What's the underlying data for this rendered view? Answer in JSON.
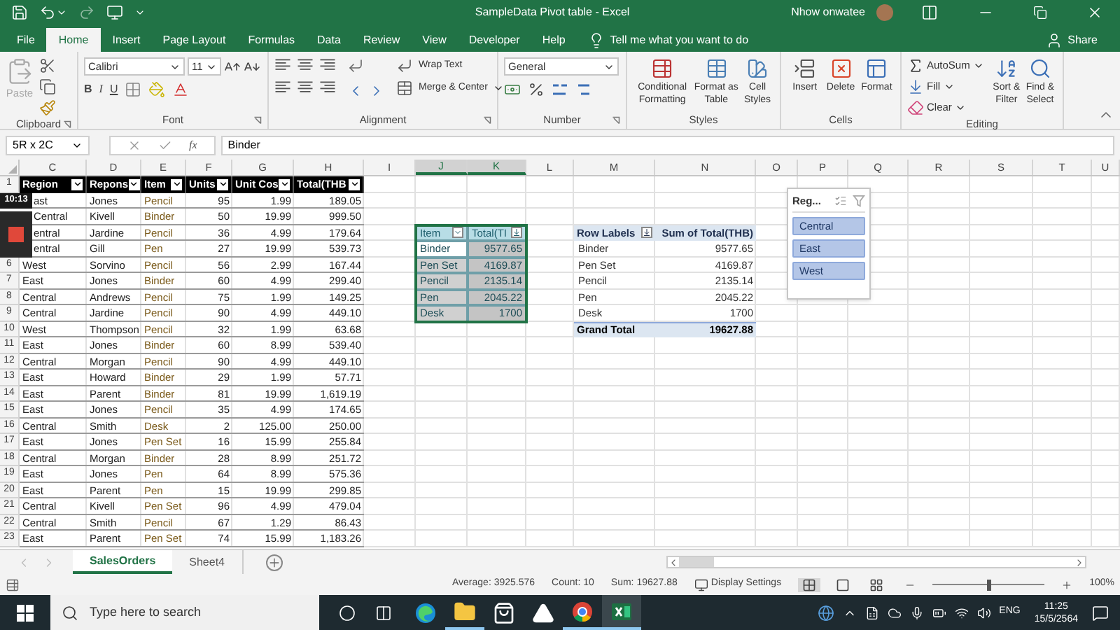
{
  "title_bar": {
    "title": "SampleData Pivot table  -  Excel",
    "user": "Nhow onwatee"
  },
  "ribbon_tabs": [
    {
      "label": "File",
      "selected": false
    },
    {
      "label": "Home",
      "selected": true
    },
    {
      "label": "Insert",
      "selected": false
    },
    {
      "label": "Page Layout",
      "selected": false
    },
    {
      "label": "Formulas",
      "selected": false
    },
    {
      "label": "Data",
      "selected": false
    },
    {
      "label": "Review",
      "selected": false
    },
    {
      "label": "View",
      "selected": false
    },
    {
      "label": "Developer",
      "selected": false
    },
    {
      "label": "Help",
      "selected": false
    }
  ],
  "tell_me": "Tell me what you want to do",
  "share": "Share",
  "ribbon": {
    "clipboard": {
      "paste": "Paste",
      "paste_disabled": true,
      "label": "Clipboard"
    },
    "font": {
      "font_name": "Calibri",
      "font_size": "11",
      "bold": "B",
      "italic": "I",
      "underline": "U",
      "label": "Font"
    },
    "alignment": {
      "wrap_text": "Wrap Text",
      "merge_center": "Merge & Center",
      "label": "Alignment"
    },
    "number": {
      "format": "General",
      "label": "Number"
    },
    "styles": {
      "buttons": [
        "Conditional Formatting",
        "Format as Table",
        "Cell Styles"
      ],
      "label": "Styles"
    },
    "cells": {
      "buttons": [
        "Insert",
        "Delete",
        "Format"
      ],
      "label": "Cells"
    },
    "editing": {
      "autosum": "AutoSum",
      "fill": "Fill",
      "clear": "Clear",
      "sort_filter": "Sort & Filter",
      "find_select": "Find & Select",
      "label": "Editing"
    }
  },
  "formula_bar": {
    "name_box": "5R x 2C",
    "function_label": "fx",
    "formula": "Binder"
  },
  "recorder": {
    "timer": "10:13"
  },
  "columns": [
    {
      "letter": "C",
      "selected": false
    },
    {
      "letter": "D",
      "selected": false
    },
    {
      "letter": "E",
      "selected": false
    },
    {
      "letter": "F",
      "selected": false
    },
    {
      "letter": "G",
      "selected": false
    },
    {
      "letter": "H",
      "selected": false
    },
    {
      "letter": "I",
      "selected": false
    },
    {
      "letter": "J",
      "selected": true
    },
    {
      "letter": "K",
      "selected": true
    },
    {
      "letter": "L",
      "selected": false
    },
    {
      "letter": "M",
      "selected": false
    },
    {
      "letter": "N",
      "selected": false
    },
    {
      "letter": "O",
      "selected": false
    },
    {
      "letter": "P",
      "selected": false
    },
    {
      "letter": "Q",
      "selected": false
    },
    {
      "letter": "R",
      "selected": false
    },
    {
      "letter": "S",
      "selected": false
    },
    {
      "letter": "T",
      "selected": false
    },
    {
      "letter": "U",
      "selected": false
    }
  ],
  "table": {
    "header_row_number": "1",
    "headers": [
      "Region",
      "Repons",
      "Item",
      "Units",
      "Unit Cos",
      "Total(THB"
    ],
    "rows": [
      {
        "cells": [
          "ast",
          "Jones",
          "Pencil",
          "95",
          "1.99",
          "189.05"
        ]
      },
      {
        "cells": [
          "Central",
          "Kivell",
          "Binder",
          "50",
          "19.99",
          "999.50"
        ]
      },
      {
        "cells": [
          "entral",
          "Jardine",
          "Pencil",
          "36",
          "4.99",
          "179.64"
        ]
      },
      {
        "cells": [
          "entral",
          "Gill",
          "Pen",
          "27",
          "19.99",
          "539.73"
        ]
      },
      {
        "number": "6",
        "cells": [
          "West",
          "Sorvino",
          "Pencil",
          "56",
          "2.99",
          "167.44"
        ]
      },
      {
        "number": "7",
        "cells": [
          "East",
          "Jones",
          "Binder",
          "60",
          "4.99",
          "299.40"
        ]
      },
      {
        "number": "8",
        "cells": [
          "Central",
          "Andrews",
          "Pencil",
          "75",
          "1.99",
          "149.25"
        ]
      },
      {
        "number": "9",
        "cells": [
          "Central",
          "Jardine",
          "Pencil",
          "90",
          "4.99",
          "449.10"
        ]
      },
      {
        "number": "10",
        "cells": [
          "West",
          "Thompson",
          "Pencil",
          "32",
          "1.99",
          "63.68"
        ]
      },
      {
        "number": "11",
        "cells": [
          "East",
          "Jones",
          "Binder",
          "60",
          "8.99",
          "539.40"
        ]
      },
      {
        "number": "12",
        "cells": [
          "Central",
          "Morgan",
          "Pencil",
          "90",
          "4.99",
          "449.10"
        ]
      },
      {
        "number": "13",
        "cells": [
          "East",
          "Howard",
          "Binder",
          "29",
          "1.99",
          "57.71"
        ]
      },
      {
        "number": "14",
        "cells": [
          "East",
          "Parent",
          "Binder",
          "81",
          "19.99",
          "1,619.19"
        ]
      },
      {
        "number": "15",
        "cells": [
          "East",
          "Jones",
          "Pencil",
          "35",
          "4.99",
          "174.65"
        ]
      },
      {
        "number": "16",
        "cells": [
          "Central",
          "Smith",
          "Desk",
          "2",
          "125.00",
          "250.00"
        ]
      },
      {
        "number": "17",
        "cells": [
          "East",
          "Jones",
          "Pen Set",
          "16",
          "15.99",
          "255.84"
        ]
      },
      {
        "number": "18",
        "cells": [
          "Central",
          "Morgan",
          "Binder",
          "28",
          "8.99",
          "251.72"
        ]
      },
      {
        "number": "19",
        "cells": [
          "East",
          "Jones",
          "Pen",
          "64",
          "8.99",
          "575.36"
        ]
      },
      {
        "number": "20",
        "cells": [
          "East",
          "Parent",
          "Pen",
          "15",
          "19.99",
          "299.85"
        ]
      },
      {
        "number": "21",
        "cells": [
          "Central",
          "Kivell",
          "Pen Set",
          "96",
          "4.99",
          "479.04"
        ]
      },
      {
        "number": "22",
        "cells": [
          "Central",
          "Smith",
          "Pencil",
          "67",
          "1.29",
          "86.43"
        ]
      },
      {
        "number": "23",
        "cells": [
          "East",
          "Parent",
          "Pen Set",
          "74",
          "15.99",
          "1,183.26"
        ]
      }
    ]
  },
  "pivot_copy": {
    "headers": [
      "Item",
      "Total(TI"
    ],
    "rows": [
      {
        "cells": [
          "Binder",
          "9577.65"
        ],
        "active": true
      },
      {
        "cells": [
          "Pen Set",
          "4169.87"
        ],
        "active": false
      },
      {
        "cells": [
          "Pencil",
          "2135.14"
        ],
        "active": false
      },
      {
        "cells": [
          "Pen",
          "2045.22"
        ],
        "active": false
      },
      {
        "cells": [
          "Desk",
          "1700"
        ],
        "active": false
      }
    ]
  },
  "pivot": {
    "headers": [
      "Row Labels",
      "Sum of Total(THB)"
    ],
    "rows": [
      [
        "Binder",
        "9577.65"
      ],
      [
        "Pen Set",
        "4169.87"
      ],
      [
        "Pencil",
        "2135.14"
      ],
      [
        "Pen",
        "2045.22"
      ],
      [
        "Desk",
        "1700"
      ]
    ],
    "total": [
      "Grand Total",
      "19627.88"
    ]
  },
  "slicer": {
    "title": "Reg...",
    "items": [
      {
        "label": "Central",
        "selected": true
      },
      {
        "label": "East",
        "selected": true
      },
      {
        "label": "West",
        "selected": true
      }
    ]
  },
  "sheet_tabs": [
    {
      "label": "SalesOrders",
      "selected": true
    },
    {
      "label": "Sheet4",
      "selected": false
    }
  ],
  "status_bar": {
    "average": "Average: 3925.576",
    "count": "Count: 10",
    "sum": "Sum: 19627.88",
    "display_settings": "Display Settings",
    "views": [
      {
        "kind": "normal",
        "selected": true
      },
      {
        "kind": "page_layout",
        "selected": false
      },
      {
        "kind": "page_break",
        "selected": false
      }
    ],
    "zoom": {
      "level": 0.5
    },
    "zoom_text": "100%"
  },
  "taskbar": {
    "search": {
      "placeholder": "Type here to search"
    },
    "apps": [
      {
        "kind": "edge",
        "running": false,
        "selected": false
      },
      {
        "kind": "explorer",
        "running": true,
        "selected": false
      },
      {
        "kind": "store",
        "running": false,
        "selected": false
      },
      {
        "kind": "app",
        "running": false,
        "selected": false
      },
      {
        "kind": "chrome",
        "running": true,
        "selected": false
      },
      {
        "kind": "excel",
        "running": true,
        "selected": true
      }
    ],
    "language": "ENG",
    "time": "11:25",
    "date": "15/5/2564"
  }
}
